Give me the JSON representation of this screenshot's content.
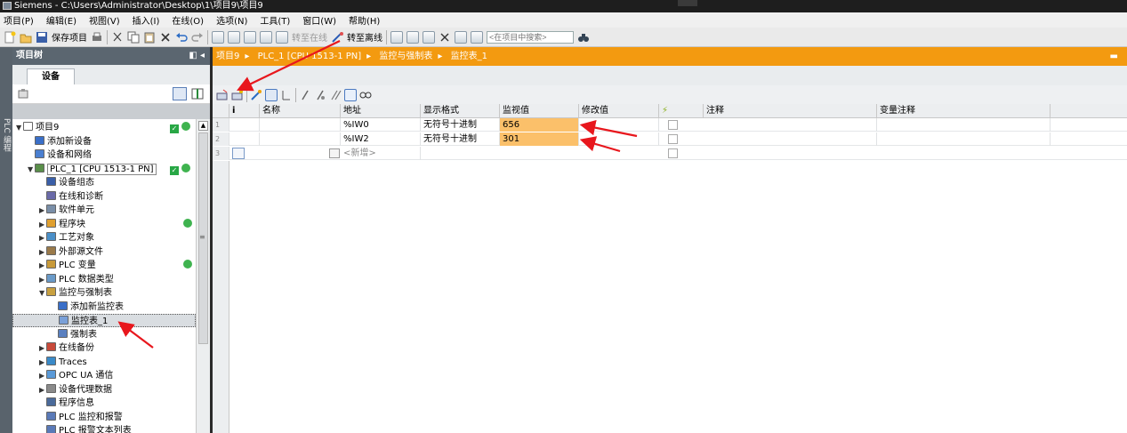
{
  "window": {
    "title": "Siemens  -  C:\\Users\\Administrator\\Desktop\\1\\项目9\\项目9"
  },
  "menu": [
    "项目(P)",
    "编辑(E)",
    "视图(V)",
    "插入(I)",
    "在线(O)",
    "选项(N)",
    "工具(T)",
    "窗口(W)",
    "帮助(H)"
  ],
  "toolbar": {
    "save_label": "保存项目",
    "go_online": "转至在线",
    "go_offline": "转至离线",
    "search_placeholder": "<在项目中搜索>"
  },
  "left_strip": {
    "label": "PLC 编程"
  },
  "project_tree": {
    "title": "项目树",
    "devices_tab": "设备",
    "items": [
      {
        "label": "项目9",
        "indent": 0,
        "expander": "▼",
        "icon": "project-icon",
        "status": "check-dot"
      },
      {
        "label": "添加新设备",
        "indent": 1,
        "expander": "",
        "icon": "add-device-icon"
      },
      {
        "label": "设备和网络",
        "indent": 1,
        "expander": "",
        "icon": "network-icon"
      },
      {
        "label": "PLC_1 [CPU 1513-1 PN]",
        "indent": 1,
        "expander": "▼",
        "icon": "plc-icon",
        "status": "check-dot",
        "selected_box": true
      },
      {
        "label": "设备组态",
        "indent": 2,
        "expander": "",
        "icon": "device-config-icon"
      },
      {
        "label": "在线和诊断",
        "indent": 2,
        "expander": "",
        "icon": "online-diag-icon"
      },
      {
        "label": "软件单元",
        "indent": 2,
        "expander": "▶",
        "icon": "software-unit-icon"
      },
      {
        "label": "程序块",
        "indent": 2,
        "expander": "▶",
        "icon": "program-block-icon",
        "status": "dot"
      },
      {
        "label": "工艺对象",
        "indent": 2,
        "expander": "▶",
        "icon": "tech-object-icon"
      },
      {
        "label": "外部源文件",
        "indent": 2,
        "expander": "▶",
        "icon": "source-file-icon"
      },
      {
        "label": "PLC 变量",
        "indent": 2,
        "expander": "▶",
        "icon": "plc-tags-icon",
        "status": "dot"
      },
      {
        "label": "PLC 数据类型",
        "indent": 2,
        "expander": "▶",
        "icon": "data-type-icon"
      },
      {
        "label": "监控与强制表",
        "indent": 2,
        "expander": "▼",
        "icon": "watch-folder-icon"
      },
      {
        "label": "添加新监控表",
        "indent": 3,
        "expander": "",
        "icon": "add-watch-icon"
      },
      {
        "label": "监控表_1",
        "indent": 3,
        "expander": "",
        "icon": "watch-table-icon",
        "selected": true
      },
      {
        "label": "强制表",
        "indent": 3,
        "expander": "",
        "icon": "force-table-icon"
      },
      {
        "label": "在线备份",
        "indent": 2,
        "expander": "▶",
        "icon": "backup-icon"
      },
      {
        "label": "Traces",
        "indent": 2,
        "expander": "▶",
        "icon": "traces-icon"
      },
      {
        "label": "OPC UA 通信",
        "indent": 2,
        "expander": "▶",
        "icon": "opcua-icon"
      },
      {
        "label": "设备代理数据",
        "indent": 2,
        "expander": "▶",
        "icon": "proxy-data-icon"
      },
      {
        "label": "程序信息",
        "indent": 2,
        "expander": "",
        "icon": "program-info-icon"
      },
      {
        "label": "PLC 监控和报警",
        "indent": 2,
        "expander": "",
        "icon": "alarm-icon"
      },
      {
        "label": "PLC 报警文本列表",
        "indent": 2,
        "expander": "",
        "icon": "alarm-text-icon"
      }
    ]
  },
  "breadcrumb": [
    "项目9",
    "PLC_1 [CPU 1513-1 PN]",
    "监控与强制表",
    "监控表_1"
  ],
  "breadcrumb_sep": "▸",
  "watch_table": {
    "columns": {
      "info": "i",
      "name": "名称",
      "address": "地址",
      "display_format": "显示格式",
      "monitor_value": "监视值",
      "modify_value": "修改值",
      "modify_flag": "⚡",
      "comment": "注释",
      "tag_comment": "变量注释"
    },
    "rows": [
      {
        "num": "1",
        "name": "",
        "address": "%IW0",
        "format": "无符号十进制",
        "monitor": "656",
        "modify": "",
        "comment": "",
        "tag_comment": ""
      },
      {
        "num": "2",
        "name": "",
        "address": "%IW2",
        "format": "无符号十进制",
        "monitor": "301",
        "modify": "",
        "comment": "",
        "tag_comment": ""
      }
    ],
    "new_row": {
      "num": "3",
      "address": "<新增>"
    }
  },
  "colors": {
    "accent_orange": "#f39a10",
    "monitor_highlight": "#fbc06a",
    "status_green": "#28a745",
    "annotation_red": "#e8171d"
  }
}
